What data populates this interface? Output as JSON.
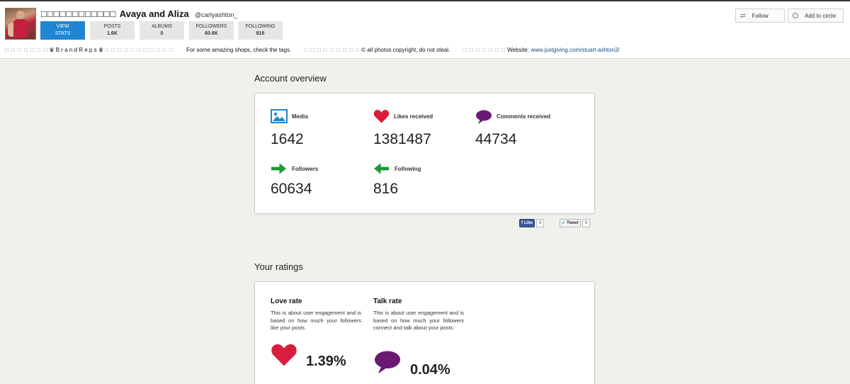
{
  "profile": {
    "name_prefix": "□□□□□□□□□□□□",
    "name": "Avaya and Aliza",
    "handle": "@carlyashton_"
  },
  "stats_buttons": [
    {
      "label": "VIEW",
      "value": "STATS"
    },
    {
      "label": "POSTS",
      "value": "1.6K"
    },
    {
      "label": "ALBUMS",
      "value": "0"
    },
    {
      "label": "FOLLOWERS",
      "value": "60.6K"
    },
    {
      "label": "FOLLOWING",
      "value": "816"
    }
  ],
  "bio": {
    "squares_1": "□ □ □ □ □ □ □",
    "brandreps": "♛ B r a n d R e p s ♛",
    "squares_2": "□ □ □ □ □ □ □ □ □ □ □",
    "shops": "For some amazing shops, check the tags.",
    "squares_3": "□ □ □ □ □ □ □ □ □",
    "copyright": "© all photos copyright, do not steal.",
    "squares_4": "□ □ □ □ □ □ □",
    "website_label": "Website:",
    "website_url": "www.justgiving.com/stuart-ashton3/"
  },
  "header_buttons": {
    "follow": "Follow",
    "add_to_circle": "Add to circle"
  },
  "account_overview": {
    "title": "Account overview",
    "metrics": [
      {
        "label": "Media",
        "value": "1642",
        "icon": "image-icon"
      },
      {
        "label": "Likes received",
        "value": "1381487",
        "icon": "heart-icon"
      },
      {
        "label": "Comments received",
        "value": "44734",
        "icon": "speech-bubble-icon"
      },
      {
        "label": "Followers",
        "value": "60634",
        "icon": "arrow-right-icon"
      },
      {
        "label": "Following",
        "value": "816",
        "icon": "arrow-left-icon"
      }
    ],
    "colors": {
      "media": "#1f86c7",
      "heart": "#d81e3d",
      "comment": "#6b1a74",
      "arrow": "#1a9a34"
    }
  },
  "social": {
    "like_label": "Like",
    "like_count": "0",
    "tweet_label": "Tweet",
    "tweet_count": "0"
  },
  "ratings": {
    "title": "Your ratings",
    "love": {
      "title": "Love rate",
      "desc": "This is about user engagement and is based on how much your followers like your posts.",
      "value": "1.39%"
    },
    "talk": {
      "title": "Talk rate",
      "desc": "This is about user engagement and is based on how much your followers connect and talk about your posts.",
      "value": "0.04%"
    }
  }
}
